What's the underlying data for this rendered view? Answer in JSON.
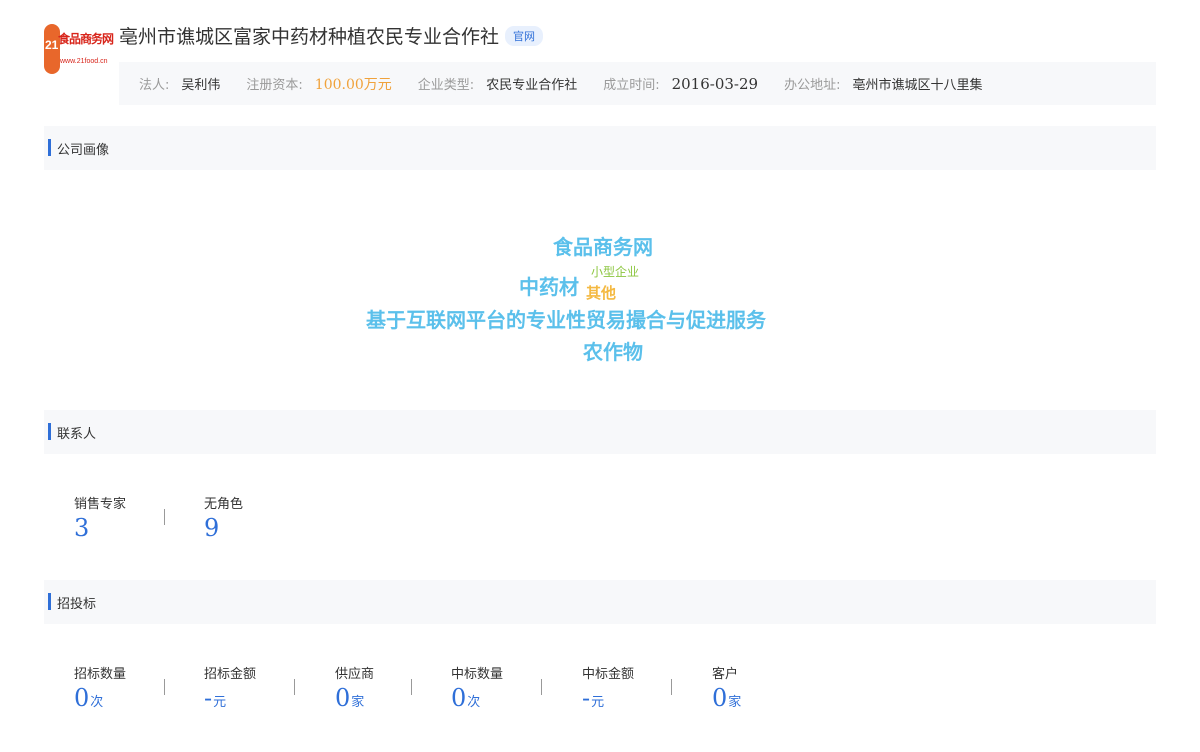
{
  "logo": {
    "num": "21",
    "text": "食品商务网",
    "url": "www.21food.cn"
  },
  "company": {
    "name": "亳州市谯城区富家中药材种植农民专业合作社",
    "badge": "官网"
  },
  "info": {
    "legal_label": "法人:",
    "legal_value": "吴利伟",
    "capital_label": "注册资本:",
    "capital_value": "100.00万元",
    "type_label": "企业类型:",
    "type_value": "农民专业合作社",
    "date_label": "成立时间:",
    "date_value": "2016-03-29",
    "address_label": "办公地址:",
    "address_value": "亳州市谯城区十八里集"
  },
  "sections": {
    "portrait": "公司画像",
    "contacts": "联系人",
    "bidding": "招投标"
  },
  "word_cloud": {
    "words": [
      {
        "text": "食品商务网",
        "color": "#5bc0eb",
        "size": "large"
      },
      {
        "text": "中药材",
        "color": "#5bc0eb",
        "size": "large"
      },
      {
        "text": "小型企业",
        "color": "#8cc63f",
        "size": "small"
      },
      {
        "text": "其他",
        "color": "#f4b942",
        "size": "medium"
      },
      {
        "text": "基于互联网平台的专业性贸易撮合与促进服务",
        "color": "#5bc0eb",
        "size": "large"
      },
      {
        "text": "农作物",
        "color": "#5bc0eb",
        "size": "large"
      }
    ]
  },
  "contacts": [
    {
      "label": "销售专家",
      "value": "3"
    },
    {
      "label": "无角色",
      "value": "9"
    }
  ],
  "bidding": [
    {
      "label": "招标数量",
      "value": "0",
      "unit": "次"
    },
    {
      "label": "招标金额",
      "value": "-",
      "unit": "元"
    },
    {
      "label": "供应商",
      "value": "0",
      "unit": "家"
    },
    {
      "label": "中标数量",
      "value": "0",
      "unit": "次"
    },
    {
      "label": "中标金额",
      "value": "-",
      "unit": "元"
    },
    {
      "label": "客户",
      "value": "0",
      "unit": "家"
    }
  ],
  "colors": {
    "accent": "#2f6fd8",
    "capital": "#f0a23b",
    "panel_bg": "#f7f8fa"
  }
}
